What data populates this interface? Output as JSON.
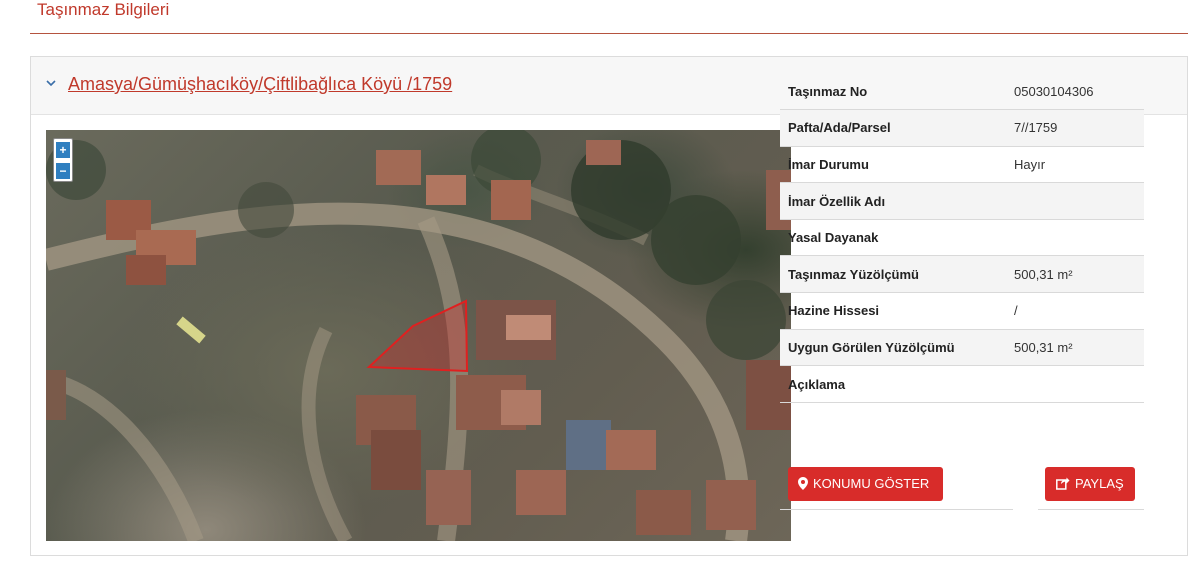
{
  "page": {
    "title": "Taşınmaz Bilgileri"
  },
  "panel": {
    "heading": "Amasya/Gümüşhacıköy/Çiftlibağlıca Köyü /1759",
    "chevron_icon": "chevron-down-icon"
  },
  "map": {
    "zoom_in_label": "+",
    "zoom_out_label": "−",
    "parcel_outline_color": "#e02020"
  },
  "info": {
    "rows": [
      {
        "label": "Taşınmaz No",
        "value": "05030104306"
      },
      {
        "label": "Pafta/Ada/Parsel",
        "value": "7//1759"
      },
      {
        "label": "İmar Durumu",
        "value": "Hayır"
      },
      {
        "label": "İmar Özellik Adı",
        "value": ""
      },
      {
        "label": "Yasal Dayanak",
        "value": ""
      },
      {
        "label": "Taşınmaz Yüzölçümü",
        "value": "500,31 m²"
      },
      {
        "label": "Hazine Hissesi",
        "value": "/"
      },
      {
        "label": "Uygun Görülen Yüzölçümü",
        "value": "500,31 m²"
      },
      {
        "label": "Açıklama",
        "value": ""
      }
    ]
  },
  "actions": {
    "show_location_label": "KONUMU GÖSTER",
    "show_location_icon": "map-marker-icon",
    "share_label": "PAYLAŞ",
    "share_icon": "share-icon"
  },
  "colors": {
    "accent": "#c0392b",
    "button_red": "#d82c2a",
    "zoom_blue": "#2f7fc0"
  }
}
